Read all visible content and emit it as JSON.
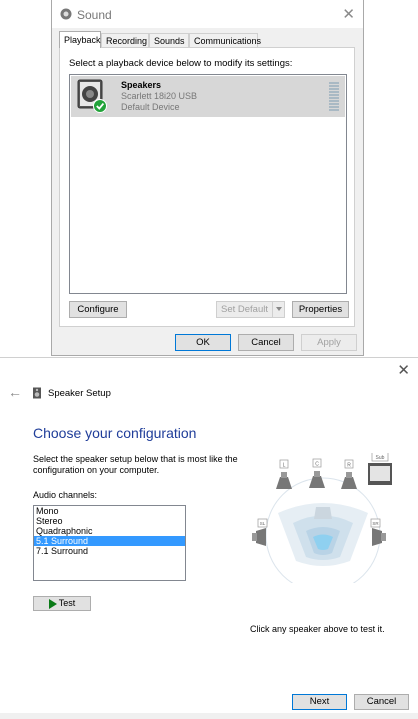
{
  "sound_dialog": {
    "title": "Sound",
    "tabs": [
      {
        "label": "Playback"
      },
      {
        "label": "Recording"
      },
      {
        "label": "Sounds"
      },
      {
        "label": "Communications"
      }
    ],
    "instruction": "Select a playback device below to modify its settings:",
    "device": {
      "name": "Speakers",
      "model": "Scarlett 18i20 USB",
      "status": "Default Device"
    },
    "buttons": {
      "configure": "Configure",
      "set_default": "Set Default",
      "properties": "Properties",
      "ok": "OK",
      "cancel": "Cancel",
      "apply": "Apply"
    }
  },
  "speaker_setup": {
    "title": "Speaker Setup",
    "heading": "Choose your configuration",
    "description": "Select the speaker setup below that is most like the configuration on your computer.",
    "channels_label": "Audio channels:",
    "channels": [
      {
        "label": "Mono",
        "selected": false
      },
      {
        "label": "Stereo",
        "selected": false
      },
      {
        "label": "Quadraphonic",
        "selected": false
      },
      {
        "label": "5.1 Surround",
        "selected": true
      },
      {
        "label": "7.1 Surround",
        "selected": false
      }
    ],
    "test_label": "Test",
    "hint": "Click any speaker above to test it.",
    "speaker_labels": {
      "left": "L",
      "center": "C",
      "right": "R",
      "sub": "Sub",
      "side_left": "SL",
      "side_right": "SR"
    },
    "buttons": {
      "next": "Next",
      "cancel": "Cancel"
    }
  },
  "colors": {
    "accent": "#0078d7",
    "heading": "#1f3d99",
    "selection": "#3399ff"
  }
}
